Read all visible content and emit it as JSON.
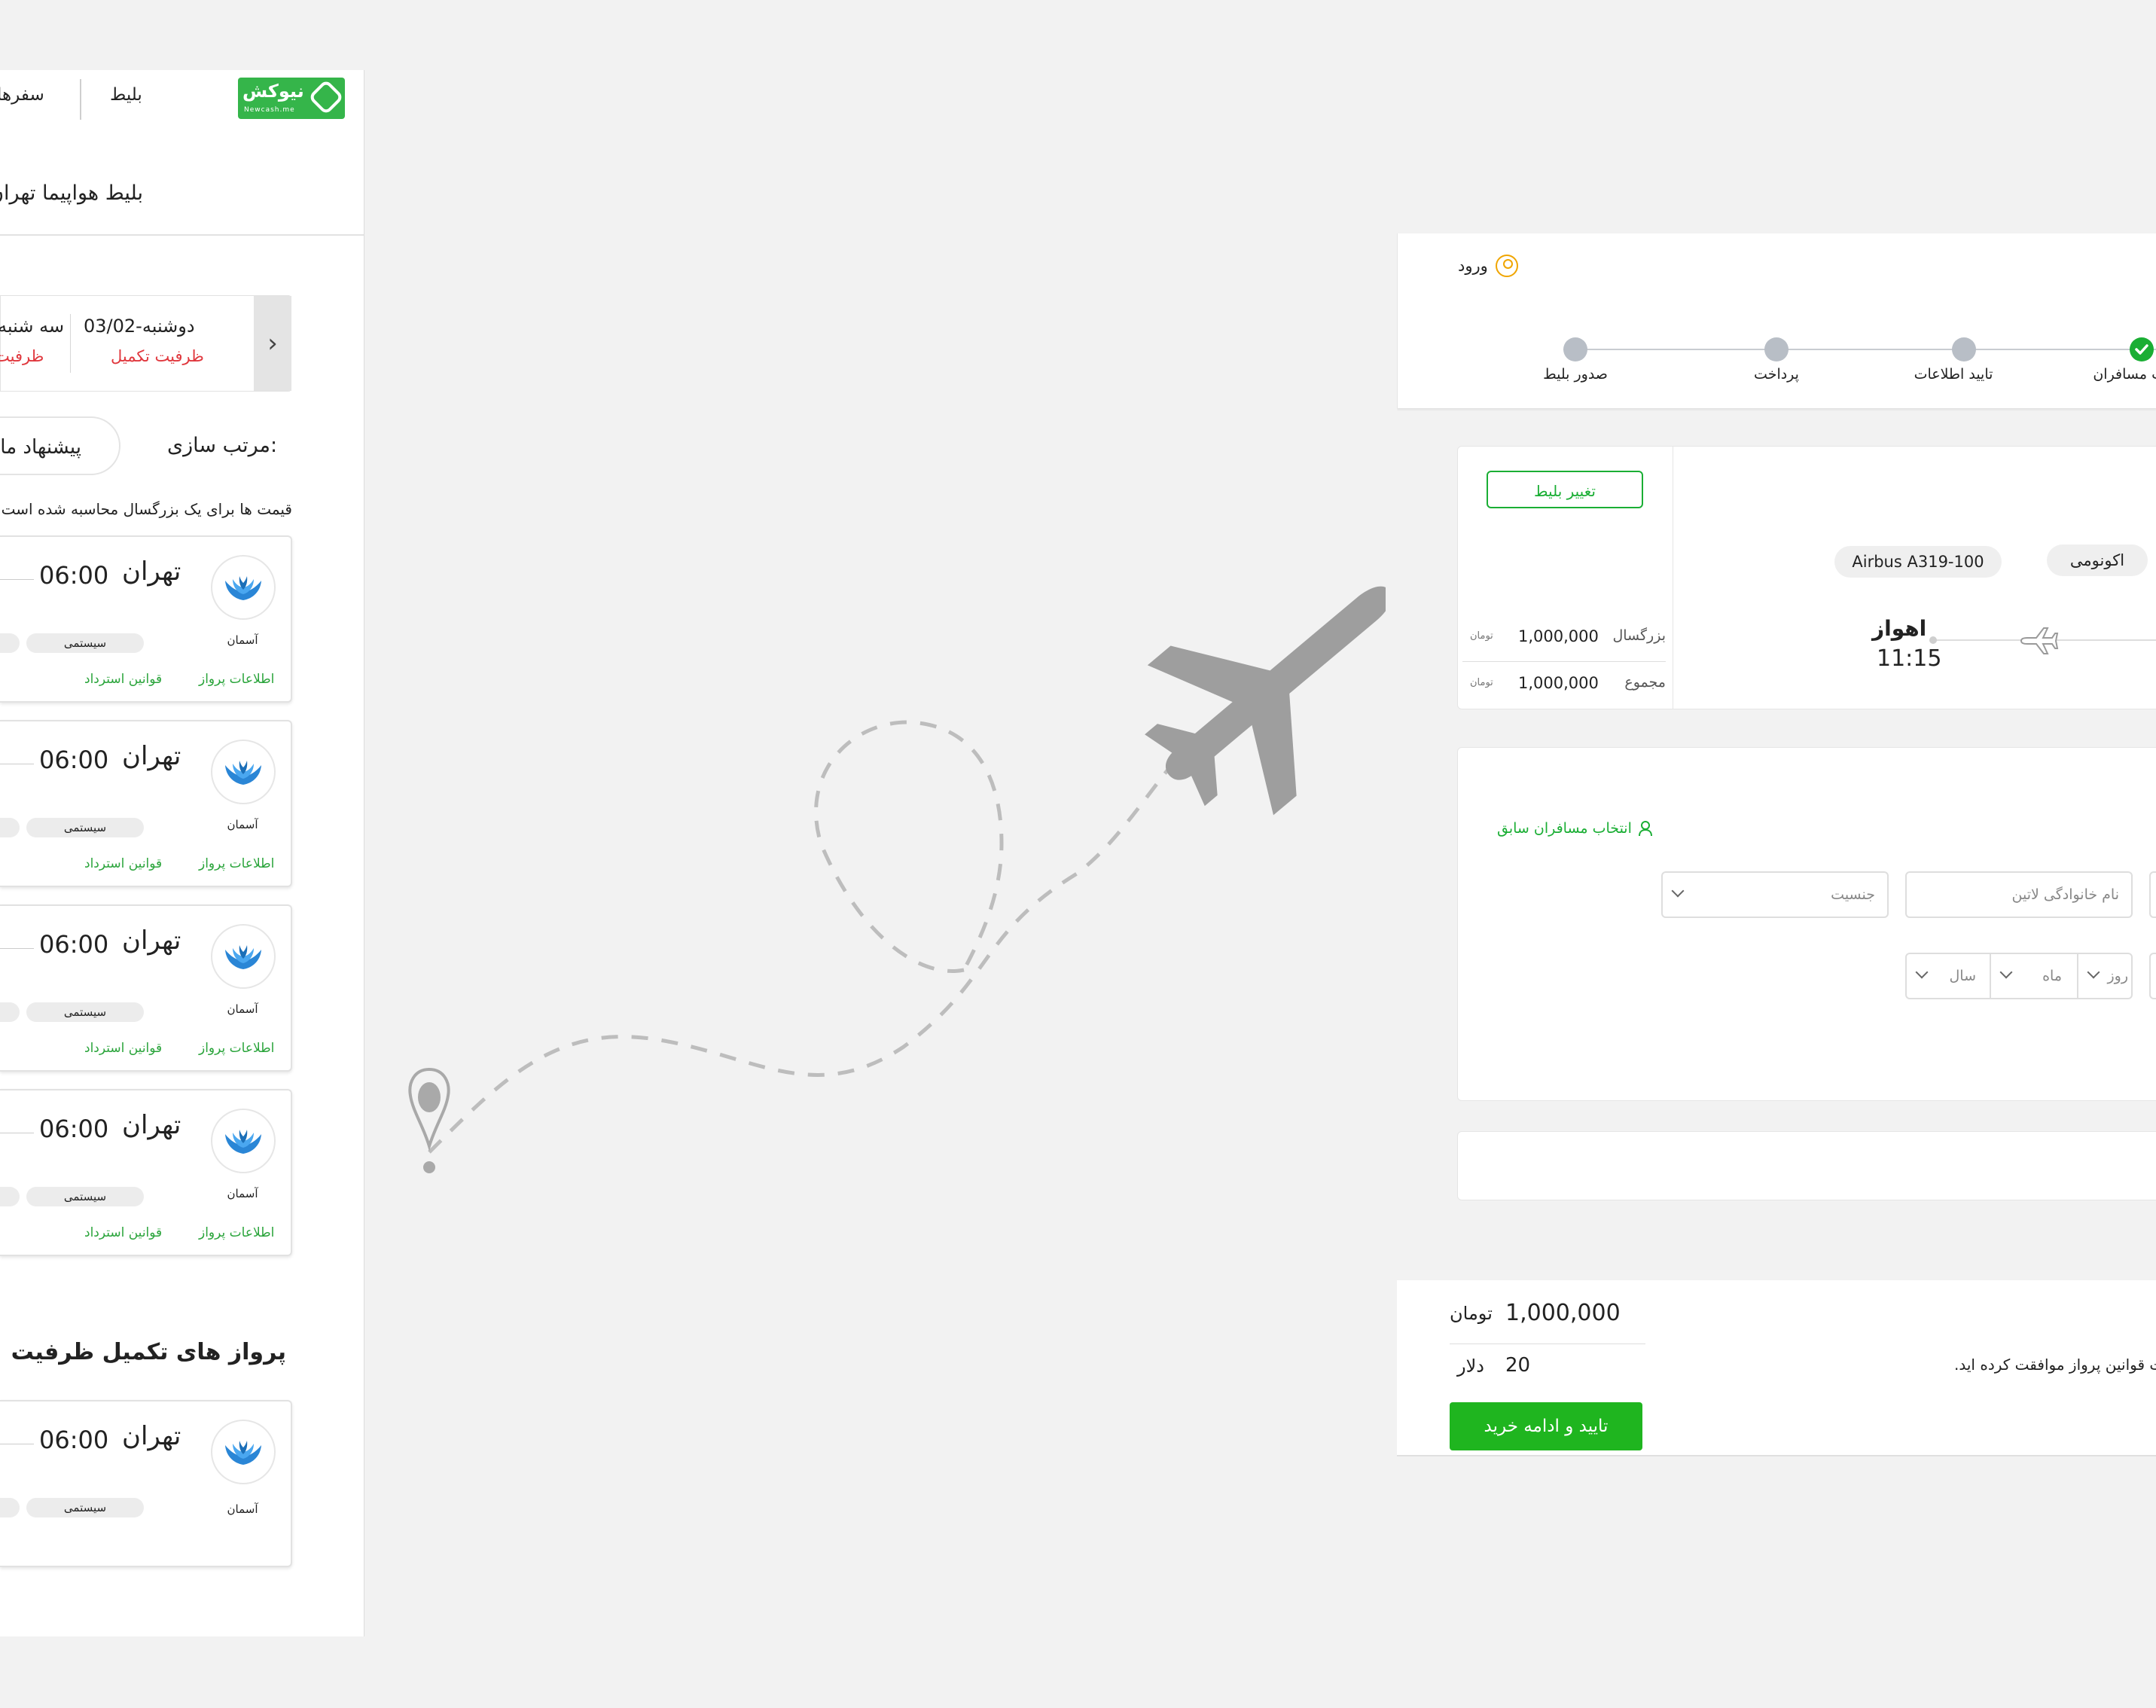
{
  "mobile": {
    "logo": {
      "text": "نیوکش",
      "sub": "Newcash.me"
    },
    "nav": {
      "ticket": "بلیط",
      "trips": "سفرها"
    },
    "page_title": "بلیط هواپیما تهران",
    "dates": [
      {
        "day": "دوشنبه-03/02",
        "status": "ظرفیت تکمیل"
      },
      {
        "day": "سه شنبه",
        "status": "ظرفیت"
      }
    ],
    "sort": {
      "label": "مرتب سازی:",
      "value": "پیشنهاد ما"
    },
    "note": "قیمت ها برای یک بزرگسال محاسبه شده است",
    "flights": [
      {
        "time": "06:00",
        "city": "تهران",
        "airline": "آسمان",
        "tag": "سیستمی",
        "link_info": "اطلاعات پرواز",
        "link_refund": "قوانین استرداد"
      },
      {
        "time": "06:00",
        "city": "تهران",
        "airline": "آسمان",
        "tag": "سیستمی",
        "link_info": "اطلاعات پرواز",
        "link_refund": "قوانین استرداد"
      },
      {
        "time": "06:00",
        "city": "تهران",
        "airline": "آسمان",
        "tag": "سیستمی",
        "link_info": "اطلاعات پرواز",
        "link_refund": "قوانین استرداد"
      },
      {
        "time": "06:00",
        "city": "تهران",
        "airline": "آسمان",
        "tag": "سیستمی",
        "link_info": "اطلاعات پرواز",
        "link_refund": "قوانین استرداد"
      }
    ],
    "full_section_title": "پرواز های تکمیل ظرفیت",
    "full_flight": {
      "time": "06:00",
      "city": "تهران",
      "airline": "آسمان",
      "tag": "سیستمی"
    }
  },
  "desktop": {
    "login": "ورود",
    "steps": [
      {
        "label": "مشخصات مسافران",
        "state": "done"
      },
      {
        "label": "تایید اطلاعات",
        "state": "pending"
      },
      {
        "label": "پرداخت",
        "state": "pending"
      },
      {
        "label": "صدور بلیط",
        "state": "pending"
      }
    ],
    "ticket": {
      "change_btn": "تغییر بلیط",
      "adult_label": "بزرگسال",
      "adult_price": "1,000,000",
      "total_label": "مجموع",
      "total_price": "1,000,000",
      "currency": "تومان",
      "class": "اکونومی",
      "aircraft": "Airbus A319-100",
      "dest_city": "اهواز",
      "dest_time": "11:15"
    },
    "passenger": {
      "prev_select": "انتخاب مسافران سابق",
      "gender_placeholder": "جنسیت",
      "lastname_placeholder": "نام خانوادگی لاتین",
      "day": "روز",
      "month": "ماه",
      "year": "سال"
    },
    "footer": {
      "total_value": "1,000,000",
      "total_currency": "تومان",
      "usd_value": "20",
      "usd_currency": "دلار",
      "agree_text": "ت قوانین پرواز موافقت کرده اید.",
      "confirm_btn": "تایید و ادامه خرید"
    }
  },
  "colors": {
    "brand": "#35b54a",
    "accent": "#1aae34",
    "warning": "#e0373d",
    "login_icon": "#f0a500"
  }
}
